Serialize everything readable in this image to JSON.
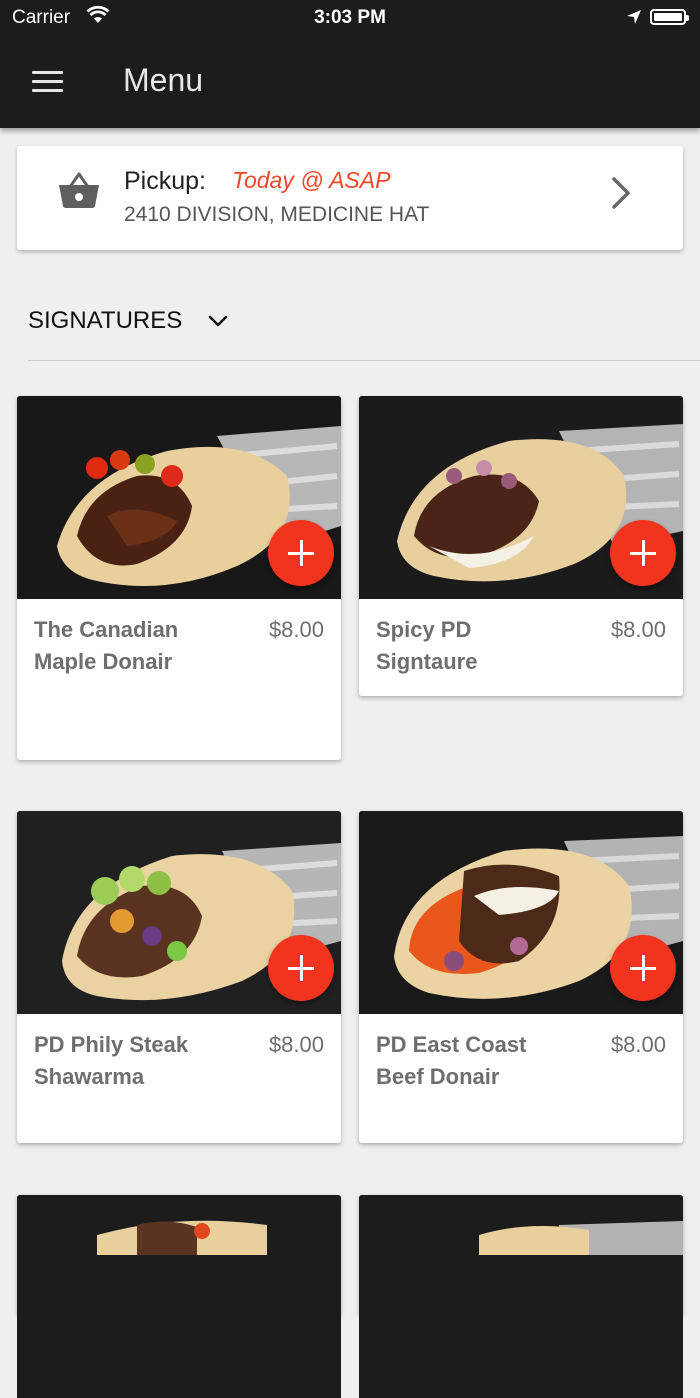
{
  "status_bar": {
    "carrier": "Carrier",
    "time": "3:03 PM"
  },
  "app_bar": {
    "title": "Menu",
    "menu_icon": "hamburger-icon"
  },
  "pickup": {
    "label": "Pickup:",
    "time": "Today @ ASAP",
    "address": "2410 DIVISION, MEDICINE HAT",
    "icon": "basket-icon"
  },
  "section": {
    "title": "SIGNATURES"
  },
  "items": [
    {
      "name": "The Canadian Maple Donair",
      "price": "$8.00"
    },
    {
      "name": "Spicy PD Signtaure",
      "price": "$8.00"
    },
    {
      "name": "PD Phily Steak Shawarma",
      "price": "$8.00"
    },
    {
      "name": "PD East Coast Beef Donair",
      "price": "$8.00"
    }
  ],
  "colors": {
    "accent": "#f2341f",
    "time_text": "#f2472b",
    "app_bar": "#1c1c1c",
    "background": "#efefef"
  }
}
